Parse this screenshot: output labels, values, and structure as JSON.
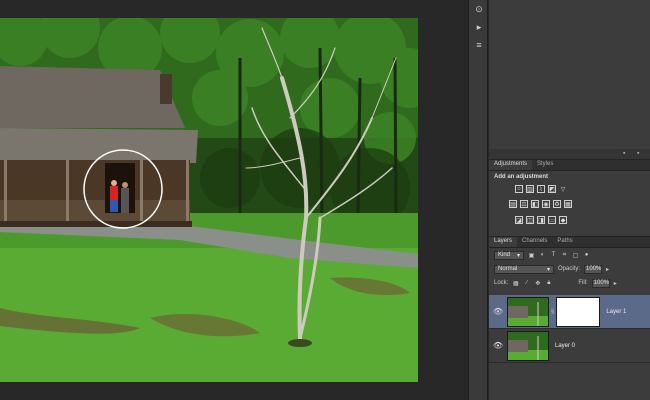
{
  "layers_panel": {
    "tabs": [
      {
        "label": "Layers",
        "active": true
      },
      {
        "label": "Channels",
        "active": false
      },
      {
        "label": "Paths",
        "active": false
      }
    ],
    "kind_filter": "Kind",
    "blend_mode": "Normal",
    "opacity_label": "Opacity:",
    "opacity_value": "100%",
    "lock_label": "Lock:",
    "fill_label": "Fill:",
    "fill_value": "100%",
    "layers": [
      {
        "name": "Layer 1",
        "selected": true,
        "has_mask": true
      },
      {
        "name": "Layer 0",
        "selected": false,
        "has_mask": false
      }
    ]
  },
  "adjustments_panel": {
    "tabs": [
      {
        "label": "Adjustments",
        "active": true
      },
      {
        "label": "Styles",
        "active": false
      }
    ],
    "title": "Add an adjustment"
  },
  "colors": {
    "selected_layer": "#5a6a88",
    "panel_bg": "#3c3c3c",
    "workspace_bg": "#282828"
  },
  "icons": {
    "tool_strip": [
      "history-icon",
      "actions-icon",
      "properties-icon"
    ]
  }
}
